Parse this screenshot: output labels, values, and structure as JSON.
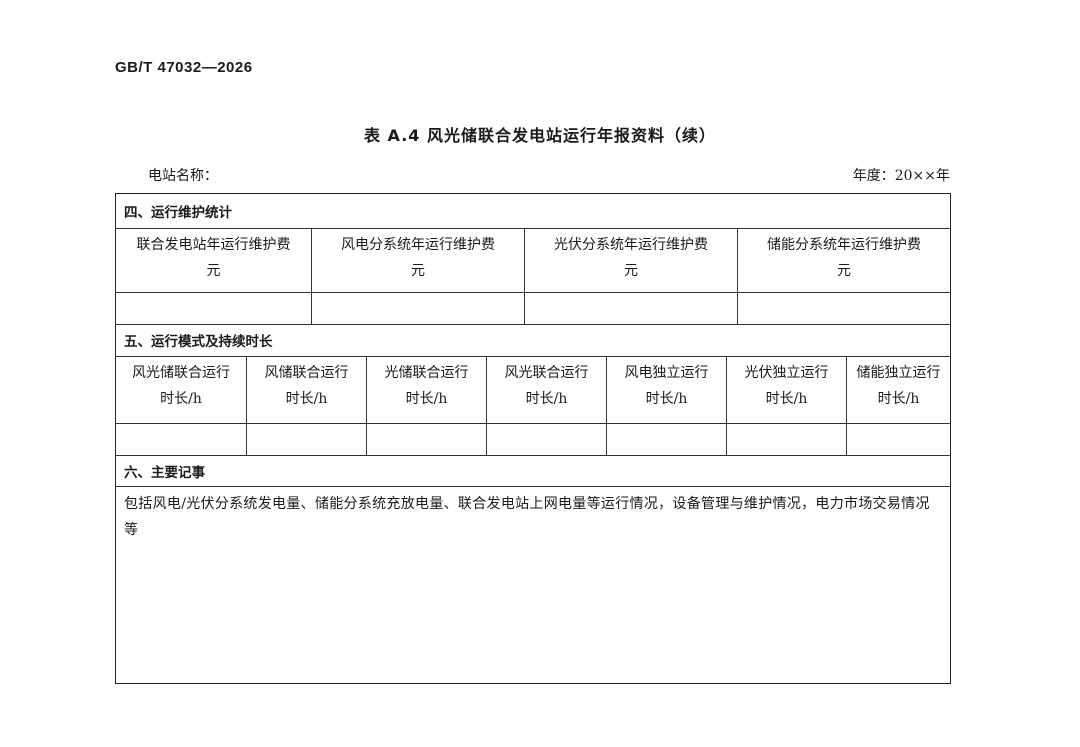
{
  "header": {
    "standard_code": "GB/T  47032—2026"
  },
  "title": "表 A.4   风光储联合发电站运行年报资料（续）",
  "meta": {
    "station_name_label": "电站名称：",
    "year_label": "年度：20××年"
  },
  "section4": {
    "heading": "四、运行维护统计",
    "columns": [
      {
        "label": "联合发电站年运行维护费",
        "unit": "元"
      },
      {
        "label": "风电分系统年运行维护费",
        "unit": "元"
      },
      {
        "label": "光伏分系统年运行维护费",
        "unit": "元"
      },
      {
        "label": "储能分系统年运行维护费",
        "unit": "元"
      }
    ]
  },
  "section5": {
    "heading": "五、运行模式及持续时长",
    "columns": [
      {
        "label": "风光储联合运行",
        "unit": "时长/h"
      },
      {
        "label": "风储联合运行",
        "unit": "时长/h"
      },
      {
        "label": "光储联合运行",
        "unit": "时长/h"
      },
      {
        "label": "风光联合运行",
        "unit": "时长/h"
      },
      {
        "label": "风电独立运行",
        "unit": "时长/h"
      },
      {
        "label": "光伏独立运行",
        "unit": "时长/h"
      },
      {
        "label": "储能独立运行",
        "unit": "时长/h"
      }
    ]
  },
  "section6": {
    "heading": "六、主要记事",
    "text": "包括风电/光伏分系统发电量、储能分系统充放电量、联合发电站上网电量等运行情况，设备管理与维护情况，电力市场交易情况等"
  }
}
